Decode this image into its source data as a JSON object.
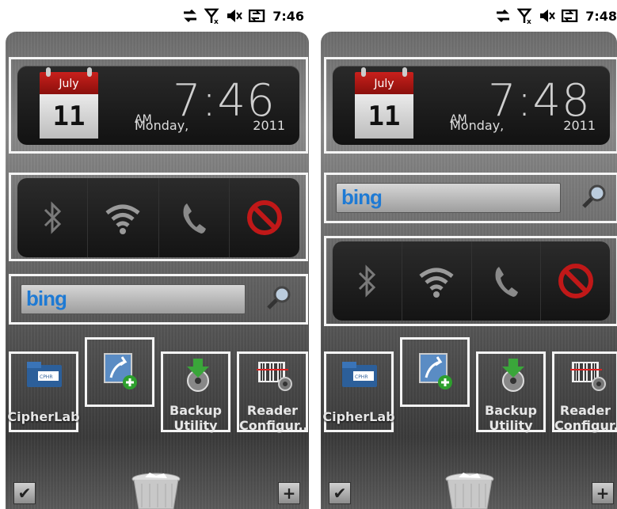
{
  "screens": [
    {
      "status": {
        "time": "7:46"
      },
      "clock": {
        "month": "July",
        "date": "11",
        "ampm": "AM",
        "time": "7:46",
        "weekday": "Monday,",
        "year": "2011"
      },
      "search": {
        "brand": "bing"
      },
      "apps": [
        {
          "label": "CipherLab",
          "icon": "folder-icon"
        },
        {
          "label": "",
          "icon": "add-shortcut-icon"
        },
        {
          "label_lines": [
            "Backup",
            "Utility"
          ],
          "icon": "backup-icon"
        },
        {
          "label_lines": [
            "Reader",
            "Configur.."
          ],
          "icon": "barcode-config-icon"
        }
      ]
    },
    {
      "status": {
        "time": "7:48"
      },
      "clock": {
        "month": "July",
        "date": "11",
        "ampm": "AM",
        "time": "7:48",
        "weekday": "Monday,",
        "year": "2011"
      },
      "search": {
        "brand": "bing"
      },
      "apps": [
        {
          "label": "CipherLab",
          "icon": "folder-icon"
        },
        {
          "label": "",
          "icon": "add-shortcut-icon"
        },
        {
          "label_lines": [
            "Backup",
            "Utility"
          ],
          "icon": "backup-icon"
        },
        {
          "label_lines": [
            "Reader",
            "Configur.."
          ],
          "icon": "barcode-config-icon"
        }
      ]
    }
  ],
  "colors": {
    "accent_red": "#c9201c",
    "bing_blue": "#1e7ad4",
    "frame_white": "#f4f4f4"
  }
}
